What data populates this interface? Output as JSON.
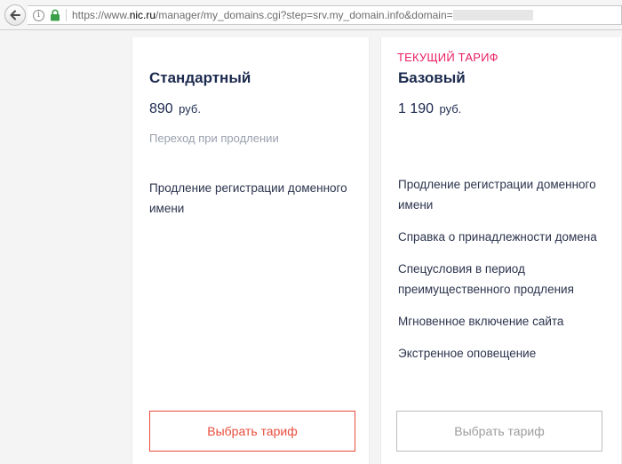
{
  "browser": {
    "url_prefix": "https://www.",
    "url_host": "nic.ru",
    "url_path": "/manager/my_domains.cgi?step=srv.my_domain.info&domain=",
    "icons": {
      "back": "back-arrow-icon",
      "info": "info-icon",
      "lock": "lock-icon"
    },
    "info_glyph": "i"
  },
  "plans": {
    "standard": {
      "title": "Стандартный",
      "price": "890",
      "currency": "руб.",
      "transition_note": "Переход при продлении",
      "features": [
        "Продление регистрации доменного имени"
      ],
      "button_label": "Выбрать тариф"
    },
    "basic": {
      "current_tag": "ТЕКУЩИЙ ТАРИФ",
      "title": "Базовый",
      "price": "1 190",
      "currency": "руб.",
      "features": [
        "Продление регистрации доменного имени",
        "Справка о принадлежности домена",
        "Спецусловия в период преимущественного продления",
        "Мгновенное включение сайта",
        "Экстренное оповещение"
      ],
      "button_label": "Выбрать тариф"
    }
  },
  "colors": {
    "accent_red": "#e84c3d",
    "current_pink": "#e91e63",
    "title_navy": "#1c2a4f"
  }
}
